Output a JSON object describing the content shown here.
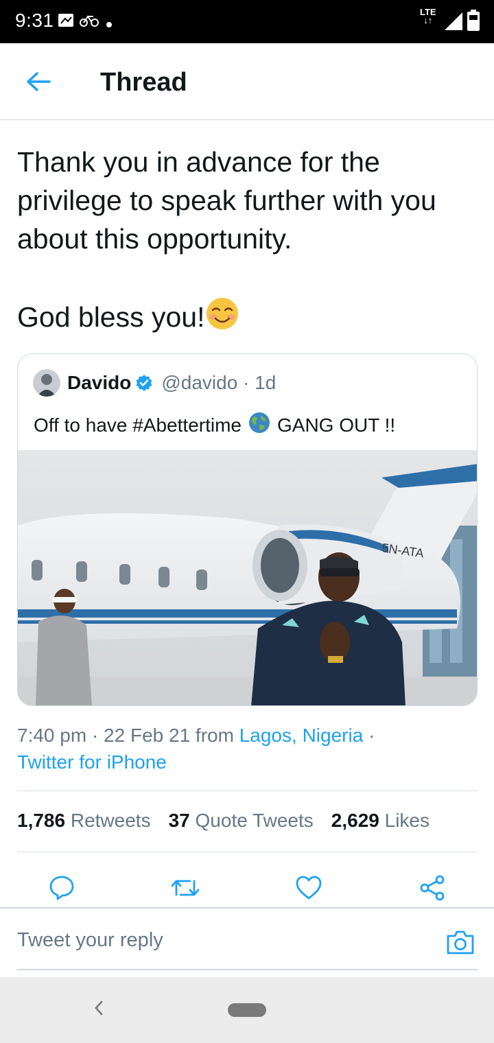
{
  "status_bar": {
    "time": "9:31",
    "network": "LTE"
  },
  "header": {
    "title": "Thread"
  },
  "tweet": {
    "text": "Thank you in advance for the privilege to speak further with you about this opportunity.\n\nGod bless you!",
    "emoji": "smiling-face-blush"
  },
  "quote": {
    "name": "Davido",
    "handle": "@davido · 1d",
    "text_before": "Off to have #Abettertime",
    "text_after": "GANG OUT !!",
    "jet_registration": "5N-ATA"
  },
  "meta": {
    "time_date": "7:40 pm · 22 Feb 21 from ",
    "location": "Lagos, Nigeria",
    "separator": " ·",
    "source": "Twitter for iPhone"
  },
  "stats": {
    "retweets_count": "1,786",
    "retweets_label": "Retweets",
    "quotes_count": "37",
    "quotes_label": "Quote Tweets",
    "likes_count": "2,629",
    "likes_label": "Likes"
  },
  "reply": {
    "placeholder": "Tweet your reply"
  },
  "colors": {
    "accent": "#1da1f2",
    "text": "#14171a",
    "muted": "#657786"
  }
}
